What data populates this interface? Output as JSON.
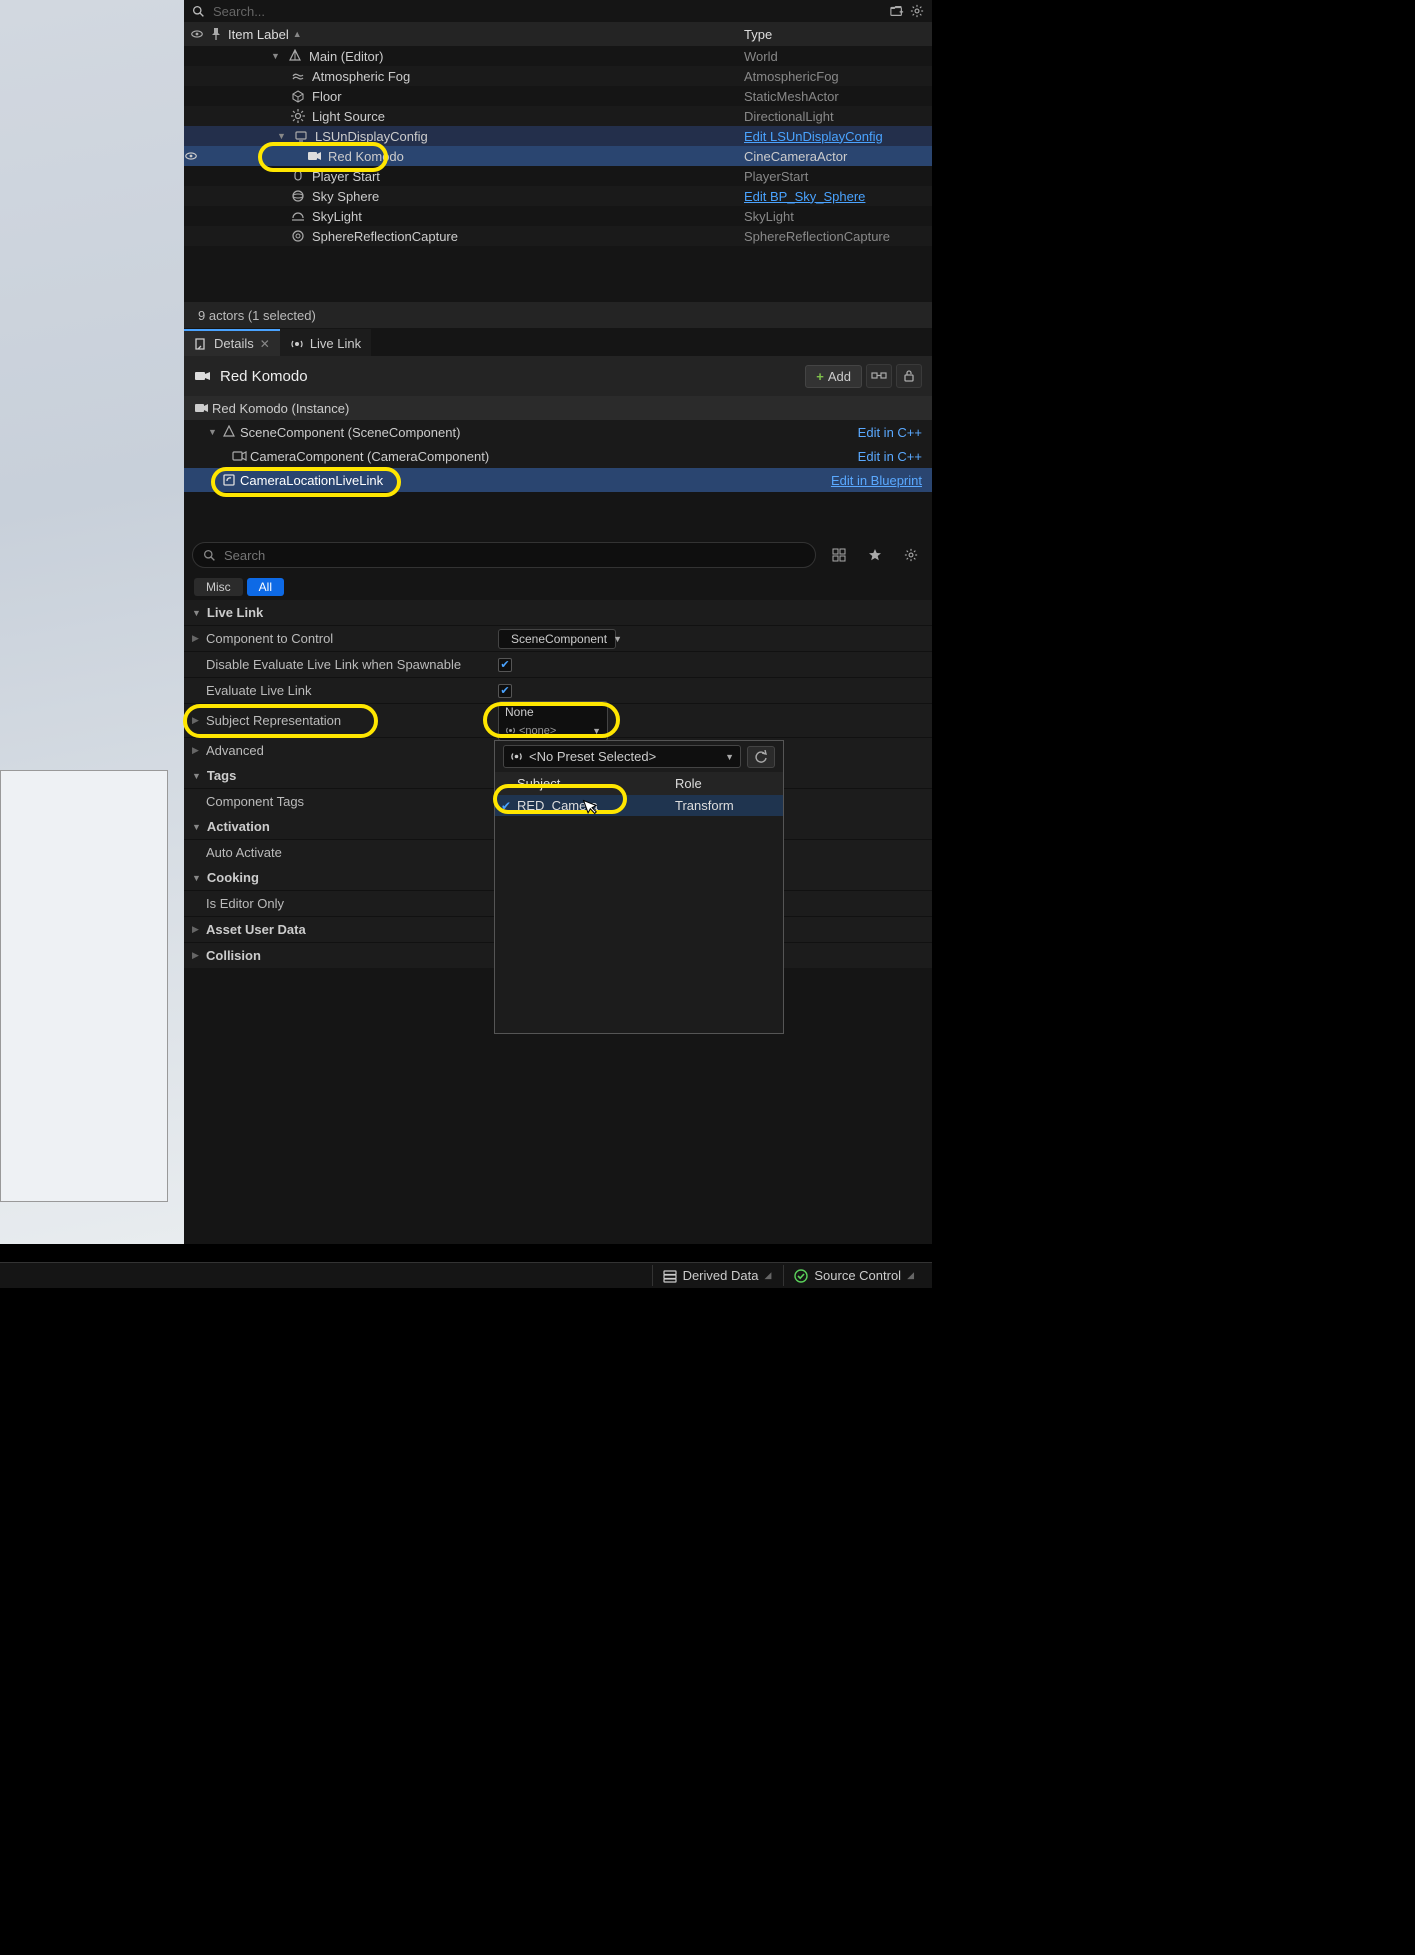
{
  "search_placeholder": "Search...",
  "outliner": {
    "col_label": "Item Label",
    "col_type": "Type",
    "rows": [
      {
        "label": "Main (Editor)",
        "type": "World"
      },
      {
        "label": "Atmospheric Fog",
        "type": "AtmosphericFog"
      },
      {
        "label": "Floor",
        "type": "StaticMeshActor"
      },
      {
        "label": "Light Source",
        "type": "DirectionalLight"
      },
      {
        "label": "LSUnDisplayConfig",
        "type": "Edit LSUnDisplayConfig"
      },
      {
        "label": "Red Komodo",
        "type": "CineCameraActor"
      },
      {
        "label": "Player Start",
        "type": "PlayerStart"
      },
      {
        "label": "Sky Sphere",
        "type": "Edit BP_Sky_Sphere"
      },
      {
        "label": "SkyLight",
        "type": "SkyLight"
      },
      {
        "label": "SphereReflectionCapture",
        "type": "SphereReflectionCapture"
      }
    ],
    "status": "9 actors (1 selected)"
  },
  "tabs": {
    "details": "Details",
    "livelink": "Live Link"
  },
  "details": {
    "actor_name": "Red Komodo",
    "add_btn": "Add",
    "instance_row": "Red Komodo (Instance)",
    "components": [
      {
        "label": "SceneComponent (SceneComponent)",
        "edit": "Edit in C++"
      },
      {
        "label": "CameraComponent (CameraComponent)",
        "edit": "Edit in C++"
      },
      {
        "label": "CameraLocationLiveLink",
        "edit": "Edit in Blueprint"
      }
    ],
    "search_placeholder": "Search",
    "chips": {
      "misc": "Misc",
      "all": "All"
    }
  },
  "props": {
    "livelink_cat": "Live Link",
    "comp_to_control": "Component to Control",
    "comp_to_control_val": "SceneComponent",
    "disable_eval": "Disable Evaluate Live Link when Spawnable",
    "eval_livelink": "Evaluate Live Link",
    "subject_rep": "Subject Representation",
    "subject_rep_val": "None",
    "subject_rep_sub": "<none>",
    "advanced": "Advanced",
    "tags_cat": "Tags",
    "component_tags": "Component Tags",
    "activation_cat": "Activation",
    "auto_activate": "Auto Activate",
    "cooking_cat": "Cooking",
    "is_editor_only": "Is Editor Only",
    "asset_user_data": "Asset User Data",
    "collision": "Collision"
  },
  "popup": {
    "preset": "<No Preset Selected>",
    "col_subject": "Subject",
    "col_role": "Role",
    "row_subject": "RED_Camera",
    "row_role": "Transform"
  },
  "bottom": {
    "derived_data": "Derived Data",
    "source_control": "Source Control"
  }
}
